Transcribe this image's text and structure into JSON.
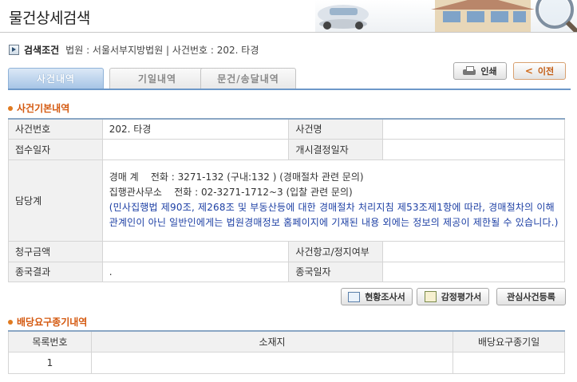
{
  "page": {
    "title": "물건상세검색"
  },
  "condition": {
    "label": "검색조건",
    "text": "법원 : 서울서부지방법원 | 사건번호 : 202. 타경"
  },
  "tabs": [
    {
      "label": "사건내역",
      "active": true
    },
    {
      "label": "기일내역",
      "active": false
    },
    {
      "label": "문건/송달내역",
      "active": false
    }
  ],
  "buttons": {
    "print": "인쇄",
    "back": "이전",
    "status_report": "현황조사서",
    "appraisal": "감정평가서",
    "interest": "관심사건등록"
  },
  "basic": {
    "section_title": "사건기본내역",
    "rows": {
      "case_no_label": "사건번호",
      "case_no_value": "202. 타경",
      "case_name_label": "사건명",
      "case_name_value": "",
      "receipt_date_label": "접수일자",
      "receipt_date_value": "",
      "start_decision_label": "개시결정일자",
      "start_decision_value": "",
      "dept_label": "담당계",
      "dept_line1": "경매 계    전화 : 3271-132 (구내:132 ) (경매절차 관련 문의)",
      "dept_line2": "집행관사무소    전화 : 02-3271-1712~3 (입찰 관련 문의)",
      "dept_notice": "(민사집행법 제90조, 제268조 및 부동산등에 대한 경매절차 처리지침 제53조제1항에 따라, 경매절차의 이해관계인이 아닌 일반인에게는 법원경매정보 홈페이지에 기재된 내용 외에는 정보의 제공이 제한될 수 있습니다.)",
      "claim_label": "청구금액",
      "claim_value": "",
      "appeal_label": "사건항고/정지여부",
      "appeal_value": "",
      "result_label": "종국결과",
      "result_value": ".",
      "end_date_label": "종국일자",
      "end_date_value": ""
    }
  },
  "dividend": {
    "section_title": "배당요구종기내역",
    "headers": [
      "목록번호",
      "소재지",
      "배당요구종기일"
    ],
    "rows": [
      {
        "no": "1",
        "location": "",
        "deadline": ""
      }
    ]
  },
  "colors": {
    "accent": "#d4580e",
    "tab_active": "#a7c5e6",
    "notice": "#1c3fa4"
  }
}
